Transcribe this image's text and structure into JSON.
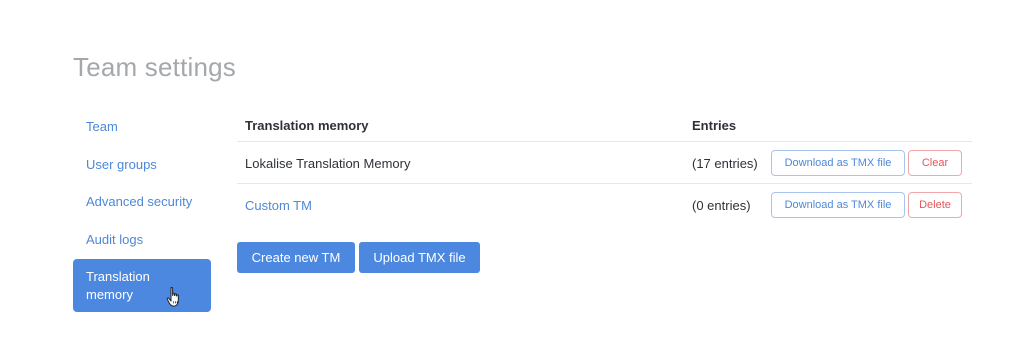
{
  "page": {
    "title": "Team settings"
  },
  "sidebar": {
    "items": [
      {
        "label": "Team"
      },
      {
        "label": "User groups"
      },
      {
        "label": "Advanced security"
      },
      {
        "label": "Audit logs"
      },
      {
        "label": "Translation memory",
        "active": true
      }
    ]
  },
  "table": {
    "headers": {
      "name": "Translation memory",
      "entries": "Entries"
    },
    "rows": [
      {
        "name": "Lokalise Translation Memory",
        "entries": "(17 entries)",
        "download_label": "Download as TMX file",
        "action_label": "Clear"
      },
      {
        "name": "Custom TM",
        "entries": "(0 entries)",
        "download_label": "Download as TMX file",
        "action_label": "Delete"
      }
    ]
  },
  "actions": {
    "create_label": "Create new TM",
    "upload_label": "Upload TMX file"
  },
  "colors": {
    "accent": "#4d88e0",
    "link": "#4d88d9",
    "danger": "#e2575b",
    "title": "#a4a8ad"
  },
  "icons": {
    "cursor": "hand-pointer-icon"
  }
}
